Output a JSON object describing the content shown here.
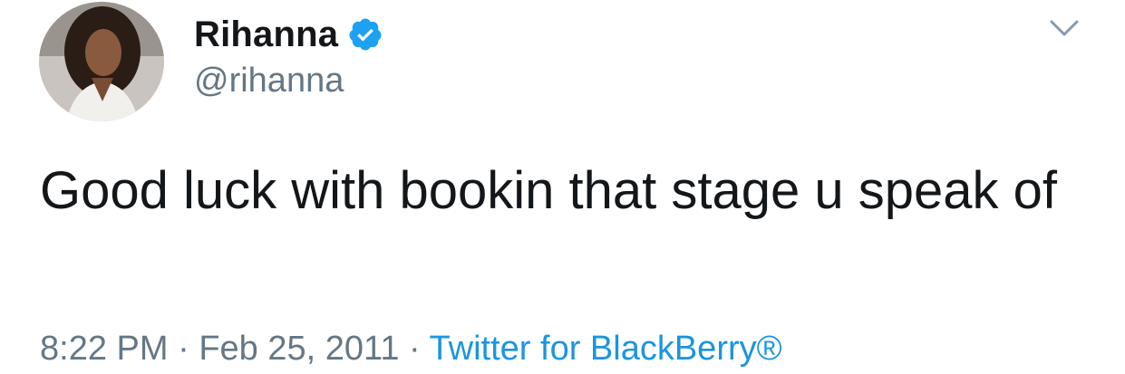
{
  "author": {
    "display_name": "Rihanna",
    "handle": "@rihanna",
    "verified": true
  },
  "tweet": {
    "text": "Good luck with bookin that stage u speak of"
  },
  "meta": {
    "time": "8:22 PM",
    "separator1": " · ",
    "date": "Feb 25, 2011",
    "separator2": " · ",
    "source": "Twitter for BlackBerry®"
  },
  "colors": {
    "verified_badge": "#1da1f2",
    "link": "#1b95e0",
    "secondary_text": "#657786"
  },
  "icons": {
    "verified": "verified-badge-icon",
    "menu": "chevron-down-icon"
  }
}
